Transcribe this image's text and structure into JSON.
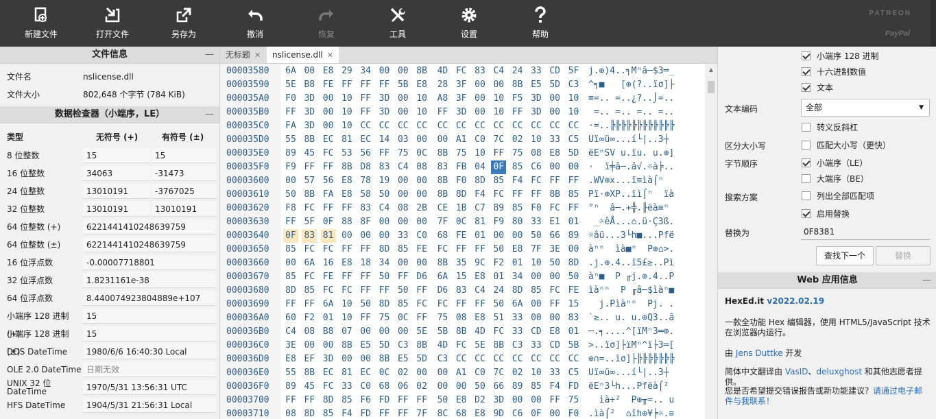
{
  "toolbar": {
    "new_file": "新建文件",
    "open_file": "打开文件",
    "save_as": "另存为",
    "undo": "撤消",
    "redo": "恢复",
    "tools": "工具",
    "settings": "设置",
    "help": "帮助",
    "patreon": "PATREON",
    "paypal": "PayPal"
  },
  "file_info": {
    "title": "文件信息",
    "name_label": "文件名",
    "name_value": "nslicense.dll",
    "size_label": "文件大小",
    "size_value": "802,648 个字节 (784 KiB)"
  },
  "inspector": {
    "title": "数据检查器（小端序，LE）",
    "col_type": "类型",
    "col_unsigned": "无符号 (+)",
    "col_signed": "有符号 (±)",
    "rows": [
      {
        "k": "8 位整数",
        "a": "15",
        "b": "15"
      },
      {
        "k": "16 位整数",
        "a": "34063",
        "b": "-31473"
      },
      {
        "k": "24 位整数",
        "a": "13010191",
        "b": "-3767025"
      },
      {
        "k": "32 位整数",
        "a": "13010191",
        "b": "13010191"
      },
      {
        "k": "64 位整数 (+)",
        "v": "6221441410248639759"
      },
      {
        "k": "64 位整数 (±)",
        "v": "6221441410248639759"
      },
      {
        "k": "16 位浮点数",
        "v": "-0.00007718801"
      },
      {
        "k": "32 位浮点数",
        "v": "1.8231161e-38"
      },
      {
        "k": "64 位浮点数",
        "v": "8.440074923804889e+107"
      },
      {
        "k": "小端序 128 进制 (+)",
        "v": "15"
      },
      {
        "k": "小端序 128 进制 (±)",
        "v": "15"
      },
      {
        "k": "DOS DateTime",
        "v": "1980/6/6 16:40:30 Local"
      },
      {
        "k": "OLE 2.0 DateTime",
        "v": "日期无效"
      },
      {
        "k": "UNIX 32 位 DateTime",
        "v": "1970/5/31 13:56:31 UTC"
      },
      {
        "k": "HFS DateTime",
        "v": "1904/5/31 21:56:31 Local"
      }
    ]
  },
  "tabs": [
    {
      "label": "无标题"
    },
    {
      "label": "nslicense.dll"
    }
  ],
  "hex_rows": [
    {
      "addr": "00003580",
      "bytes": [
        "6A",
        "00",
        "E8",
        "29",
        "34",
        "00",
        "00",
        "8B",
        "4D",
        "FC",
        "83",
        "C4",
        "24",
        "33",
        "CD",
        "5F"
      ],
      "text": "j.⊕)4..╕Mⁿâ─$3═_"
    },
    {
      "addr": "00003590",
      "bytes": [
        "5E",
        "B8",
        "FE",
        "FF",
        "FF",
        "FF",
        "5B",
        "E8",
        "28",
        "3F",
        "00",
        "00",
        "8B",
        "E5",
        "5D",
        "C3"
      ],
      "text": "^╕■   [⊕(?..ïσ]├"
    },
    {
      "addr": "000035A0",
      "bytes": [
        "F0",
        "3D",
        "00",
        "10",
        "FF",
        "3D",
        "00",
        "10",
        "A8",
        "3F",
        "00",
        "10",
        "F5",
        "3D",
        "00",
        "10"
      ],
      "text": "≡=.. =..¿?..⌡=.."
    },
    {
      "addr": "000035B0",
      "bytes": [
        "FF",
        "3D",
        "00",
        "10",
        "FF",
        "3D",
        "00",
        "10",
        "FF",
        "3D",
        "00",
        "10",
        "FF",
        "3D",
        "00",
        "10"
      ],
      "text": " =.. =.. =.. =.."
    },
    {
      "addr": "000035C0",
      "bytes": [
        "FA",
        "3D",
        "00",
        "10",
        "CC",
        "CC",
        "CC",
        "CC",
        "CC",
        "CC",
        "CC",
        "CC",
        "CC",
        "CC",
        "CC",
        "CC"
      ],
      "text": "·=..╠╠╠╠╠╠╠╠╠╠╠╠"
    },
    {
      "addr": "000035D0",
      "bytes": [
        "55",
        "8B",
        "EC",
        "81",
        "EC",
        "14",
        "03",
        "00",
        "00",
        "A1",
        "C0",
        "7C",
        "02",
        "10",
        "33",
        "C5"
      ],
      "text": "Uï∞ü∞...í└|..3┼"
    },
    {
      "addr": "000035E0",
      "bytes": [
        "89",
        "45",
        "FC",
        "53",
        "56",
        "FF",
        "75",
        "0C",
        "8B",
        "75",
        "10",
        "FF",
        "75",
        "08",
        "E8",
        "5D"
      ],
      "text": "ëEⁿSV u.ïu. u.⊕]"
    },
    {
      "addr": "000035F0",
      "bytes": [
        "F9",
        "FF",
        "FF",
        "8B",
        "D8",
        "83",
        "C4",
        "08",
        "83",
        "FB",
        "04",
        "0F",
        "85",
        "C6",
        "00",
        "00"
      ],
      "text": "·  ï╪â─.â√.☼à╞.."
    },
    {
      "addr": "00003600",
      "bytes": [
        "00",
        "57",
        "56",
        "E8",
        "78",
        "19",
        "00",
        "00",
        "8B",
        "F0",
        "8D",
        "85",
        "F4",
        "FC",
        "FF",
        "FF"
      ],
      "text": ".WV⊕x...ï≡ìà⌠ⁿ  "
    },
    {
      "addr": "00003610",
      "bytes": [
        "50",
        "8B",
        "FA",
        "E8",
        "58",
        "50",
        "00",
        "00",
        "8B",
        "8D",
        "F4",
        "FC",
        "FF",
        "FF",
        "8B",
        "85"
      ],
      "text": "Pï·⊕XP..ïì⌠ⁿ  ïà"
    },
    {
      "addr": "00003620",
      "bytes": [
        "F8",
        "FC",
        "FF",
        "FF",
        "83",
        "C4",
        "08",
        "2B",
        "CE",
        "1B",
        "C7",
        "89",
        "85",
        "F0",
        "FC",
        "FF"
      ],
      "text": "°ⁿ  â─.+╬.╟ëà≡ⁿ "
    },
    {
      "addr": "00003630",
      "bytes": [
        "FF",
        "5F",
        "0F",
        "88",
        "8F",
        "00",
        "00",
        "00",
        "7F",
        "0C",
        "81",
        "F9",
        "80",
        "33",
        "E1",
        "01"
      ],
      "text": " _☼êÅ...⌂.ü·Ç3ß."
    },
    {
      "addr": "00003640",
      "bytes": [
        "0F",
        "83",
        "81",
        "00",
        "00",
        "00",
        "33",
        "C0",
        "68",
        "FE",
        "01",
        "00",
        "00",
        "50",
        "66",
        "89"
      ],
      "text": "☼âü...3└h■...Pfë"
    },
    {
      "addr": "00003650",
      "bytes": [
        "85",
        "FC",
        "FC",
        "FF",
        "FF",
        "8D",
        "85",
        "FE",
        "FC",
        "FF",
        "FF",
        "50",
        "E8",
        "7F",
        "3E",
        "00"
      ],
      "text": "àⁿⁿ  ìà■ⁿ  P⊕⌂>."
    },
    {
      "addr": "00003660",
      "bytes": [
        "00",
        "6A",
        "16",
        "E8",
        "18",
        "34",
        "00",
        "00",
        "8B",
        "35",
        "9C",
        "F2",
        "01",
        "10",
        "50",
        "8D"
      ],
      "text": ".j.⊕.4..ï5£≥..Pì"
    },
    {
      "addr": "00003670",
      "bytes": [
        "85",
        "FC",
        "FE",
        "FF",
        "FF",
        "50",
        "FF",
        "D6",
        "6A",
        "15",
        "E8",
        "01",
        "34",
        "00",
        "00",
        "50"
      ],
      "text": "àⁿ■  P ╓j.⊕.4..P"
    },
    {
      "addr": "00003680",
      "bytes": [
        "8D",
        "85",
        "FC",
        "FC",
        "FF",
        "FF",
        "50",
        "FF",
        "D6",
        "83",
        "C4",
        "24",
        "8D",
        "85",
        "FC",
        "FE"
      ],
      "text": "ìàⁿⁿ  P ╓â─$ìàⁿ■"
    },
    {
      "addr": "00003690",
      "bytes": [
        "FF",
        "FF",
        "6A",
        "10",
        "50",
        "8D",
        "85",
        "FC",
        "FC",
        "FF",
        "FF",
        "50",
        "6A",
        "00",
        "FF",
        "15"
      ],
      "text": "  j.Pìàⁿⁿ  Pj. ."
    },
    {
      "addr": "000036A0",
      "bytes": [
        "60",
        "F2",
        "01",
        "10",
        "FF",
        "75",
        "0C",
        "FF",
        "75",
        "08",
        "E8",
        "51",
        "33",
        "00",
        "00",
        "83"
      ],
      "text": "`≥.. u. u.⊕Q3..â"
    },
    {
      "addr": "000036B0",
      "bytes": [
        "C4",
        "08",
        "B8",
        "07",
        "00",
        "00",
        "00",
        "5E",
        "5B",
        "8B",
        "4D",
        "FC",
        "33",
        "CD",
        "E8",
        "01"
      ],
      "text": "─.╕....^[ïMⁿ3═⊕."
    },
    {
      "addr": "000036C0",
      "bytes": [
        "3E",
        "00",
        "00",
        "8B",
        "E5",
        "5D",
        "C3",
        "8B",
        "4D",
        "FC",
        "5E",
        "8B",
        "C3",
        "33",
        "CD",
        "5B"
      ],
      "text": ">..ïσ]├ïMⁿ^ï├3═["
    },
    {
      "addr": "000036D0",
      "bytes": [
        "E8",
        "EF",
        "3D",
        "00",
        "00",
        "8B",
        "E5",
        "5D",
        "C3",
        "CC",
        "CC",
        "CC",
        "CC",
        "CC",
        "CC",
        "CC"
      ],
      "text": "⊕∩=..ïσ]├╠╠╠╠╠╠╠"
    },
    {
      "addr": "000036E0",
      "bytes": [
        "55",
        "8B",
        "EC",
        "81",
        "EC",
        "0C",
        "02",
        "00",
        "00",
        "A1",
        "C0",
        "7C",
        "02",
        "10",
        "33",
        "C5"
      ],
      "text": "Uï∞ü∞...í└|..3┼"
    },
    {
      "addr": "000036F0",
      "bytes": [
        "89",
        "45",
        "FC",
        "33",
        "C0",
        "68",
        "06",
        "02",
        "00",
        "00",
        "50",
        "66",
        "89",
        "85",
        "F4",
        "FD"
      ],
      "text": "ëEⁿ3└h...Pfëà⌠²"
    },
    {
      "addr": "00003700",
      "bytes": [
        "FF",
        "FF",
        "8D",
        "85",
        "F6",
        "FD",
        "FF",
        "FF",
        "50",
        "E8",
        "D2",
        "3D",
        "00",
        "00",
        "FF",
        "75"
      ],
      "text": "  ìà÷²  P⊕╥=.. u"
    },
    {
      "addr": "00003710",
      "bytes": [
        "08",
        "8D",
        "85",
        "F4",
        "FD",
        "FF",
        "FF",
        "7F",
        "8C",
        "68",
        "E8",
        "9D",
        "C6",
        "0F",
        "00",
        "F0"
      ],
      "text": ".ìà⌠²  ⌂îh⊕¥╞☼.≡"
    }
  ],
  "right_panel": {
    "opt_ule128": "小端序 128 进制",
    "opt_hex": "十六进制数值",
    "opt_text": "文本",
    "encoding_label": "文本编码",
    "encoding_value": "全部",
    "opt_escape": "转义反斜杠",
    "case_label": "区分大小写",
    "opt_case": "匹配大小写（更快）",
    "byteorder_label": "字节顺序",
    "opt_le": "小端序（LE）",
    "opt_be": "大端序（BE）",
    "search_label": "搜索方案",
    "opt_list_all": "列出全部匹配项",
    "opt_replace": "启用替换",
    "replace_label": "替换为",
    "replace_value": "0F8381",
    "find_next": "查找下一个",
    "replace_btn": "替换",
    "web_title": "Web 应用信息",
    "app_name": "HexEd.it",
    "app_version": "v2022.02.19",
    "desc": "一款全功能 Hex 编辑器，使用 HTML5/JavaScript 技术在浏览器内运行。",
    "by_prefix": "由 ",
    "author": "Jens Duttke",
    "by_suffix": " 开发",
    "trans_prefix": "简体中文翻译由 ",
    "trans1": "VasID",
    "trans_sep": "、",
    "trans2": "deluxghost",
    "trans_suffix": " 和其他志愿者提供。",
    "feedback_prefix": "您是否希望提交错误报告或新功能建议？",
    "feedback_link": "请通过电子邮件与我联系！"
  }
}
